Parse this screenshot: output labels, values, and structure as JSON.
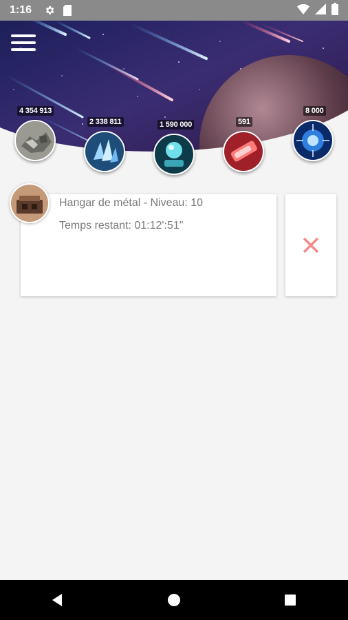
{
  "status_bar": {
    "time": "1:16",
    "icons": [
      "settings-icon",
      "sd-card-icon",
      "wifi-icon",
      "signal-icon",
      "battery-icon"
    ]
  },
  "header": {
    "menu_icon": "hamburger-menu-icon"
  },
  "resources": [
    {
      "name": "metal",
      "count": "4 354 913",
      "icon": "metal-ore-icon"
    },
    {
      "name": "crystal",
      "count": "2 338 811",
      "icon": "crystal-icon"
    },
    {
      "name": "deuterium",
      "count": "1 590 000",
      "icon": "deuterium-icon"
    },
    {
      "name": "energy-red",
      "count": "591",
      "icon": "red-energy-icon"
    },
    {
      "name": "energy-blue",
      "count": "8 000",
      "icon": "blue-energy-icon"
    }
  ],
  "queue": {
    "item_title": "Hangar de métal - Niveau: 10",
    "time_remaining": "Temps restant: 01:12':51\"",
    "cancel_icon": "close-icon"
  },
  "colors": {
    "cancel": "#f28b8b",
    "status_bar": "#8a8a8a",
    "background": "#f4f4f4"
  },
  "nav": [
    "back-icon",
    "home-icon",
    "recents-icon"
  ]
}
